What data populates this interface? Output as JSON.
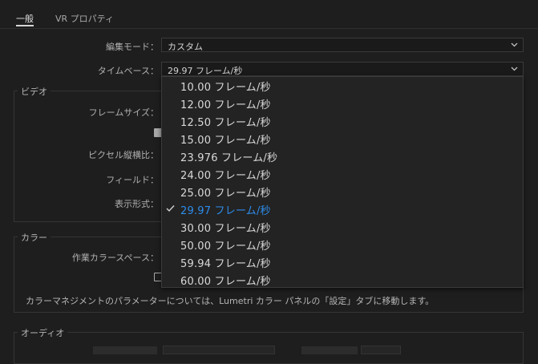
{
  "tabs": [
    {
      "label": "一般"
    },
    {
      "label": "VR プロパティ"
    }
  ],
  "general": {
    "edit_mode_label": "編集モード：",
    "edit_mode_value": "カスタム",
    "timebase_label": "タイムベース：",
    "timebase_value": "29.97  フレーム/秒"
  },
  "video": {
    "title": "ビデオ",
    "frame_size_label": "フレームサイズ：",
    "pixel_aspect_label": "ピクセル縦横比：",
    "fields_label": "フィールド：",
    "display_format_label": "表示形式："
  },
  "color": {
    "title": "カラー",
    "working_space_label": "作業カラースペース：",
    "note": "カラーマネジメントのパラメーターについては、Lumetri カラー パネルの「設定」タブに移動します。"
  },
  "audio": {
    "title": "オーディオ"
  },
  "timebase_dropdown": {
    "options": [
      {
        "label": "10.00  フレーム/秒",
        "selected": false
      },
      {
        "label": "12.00  フレーム/秒",
        "selected": false
      },
      {
        "label": "12.50  フレーム/秒",
        "selected": false
      },
      {
        "label": "15.00  フレーム/秒",
        "selected": false
      },
      {
        "label": "23.976  フレーム/秒",
        "selected": false
      },
      {
        "label": "24.00  フレーム/秒",
        "selected": false
      },
      {
        "label": "25.00  フレーム/秒",
        "selected": false
      },
      {
        "label": "29.97  フレーム/秒",
        "selected": true
      },
      {
        "label": "30.00  フレーム/秒",
        "selected": false
      },
      {
        "label": "50.00  フレーム/秒",
        "selected": false
      },
      {
        "label": "59.94  フレーム/秒",
        "selected": false
      },
      {
        "label": "60.00  フレーム/秒",
        "selected": false
      }
    ],
    "selected_color": "#2d8ceb"
  }
}
